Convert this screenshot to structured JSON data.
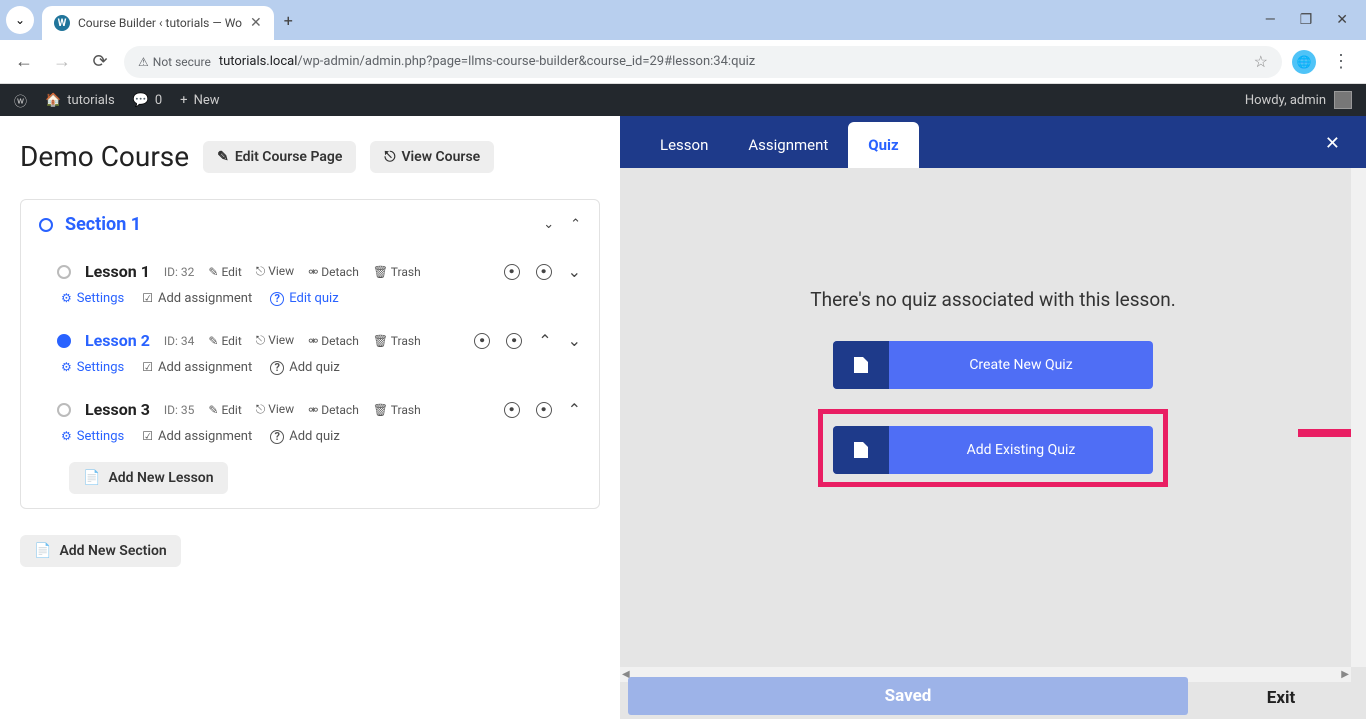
{
  "browser": {
    "tab_title": "Course Builder ‹ tutorials — Wo",
    "security": "Not secure",
    "url_host": "tutorials.local",
    "url_path": "/wp-admin/admin.php?page=llms-course-builder&course_id=29#lesson:34:quiz"
  },
  "wp_bar": {
    "site": "tutorials",
    "comments": "0",
    "new": "New",
    "howdy": "Howdy, admin"
  },
  "course": {
    "title": "Demo Course",
    "edit_page": "Edit Course Page",
    "view_course": "View Course"
  },
  "section": {
    "title": "Section 1",
    "lessons": [
      {
        "title": "Lesson 1",
        "id": "ID: 32",
        "edit": "Edit",
        "view": "View",
        "detach": "Detach",
        "trash": "Trash",
        "settings": "Settings",
        "assign": "Add assignment",
        "quiz": "Edit quiz",
        "quiz_blue": true,
        "active": false,
        "chevrons": [
          "down"
        ]
      },
      {
        "title": "Lesson 2",
        "id": "ID: 34",
        "edit": "Edit",
        "view": "View",
        "detach": "Detach",
        "trash": "Trash",
        "settings": "Settings",
        "assign": "Add assignment",
        "quiz": "Add quiz",
        "quiz_blue": false,
        "active": true,
        "chevrons": [
          "up",
          "down"
        ]
      },
      {
        "title": "Lesson 3",
        "id": "ID: 35",
        "edit": "Edit",
        "view": "View",
        "detach": "Detach",
        "trash": "Trash",
        "settings": "Settings",
        "assign": "Add assignment",
        "quiz": "Add quiz",
        "quiz_blue": false,
        "active": false,
        "chevrons": [
          "up"
        ]
      }
    ],
    "add_lesson": "Add New Lesson"
  },
  "add_section": "Add New Section",
  "right": {
    "tabs": {
      "lesson": "Lesson",
      "assignment": "Assignment",
      "quiz": "Quiz"
    },
    "empty": "There's no quiz associated with this lesson.",
    "create": "Create New Quiz",
    "add_existing": "Add Existing Quiz",
    "saved": "Saved",
    "exit": "Exit"
  }
}
